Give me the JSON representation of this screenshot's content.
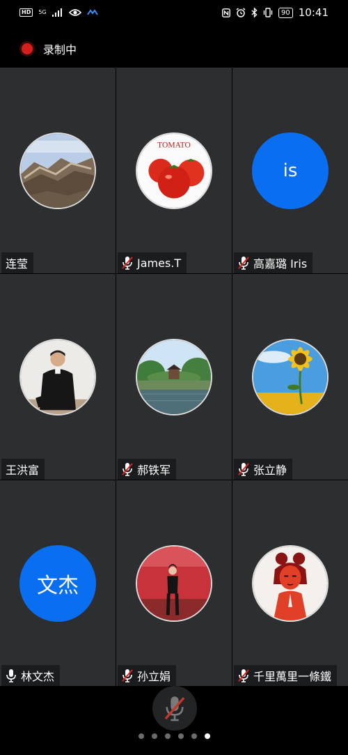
{
  "status_bar": {
    "network_badge": "HD",
    "signal_type": "5G",
    "battery": "90",
    "time": "10:41"
  },
  "recording": {
    "label": "录制中"
  },
  "participants": [
    {
      "name": "连莹",
      "mic": "none"
    },
    {
      "name": "James.T",
      "mic": "muted"
    },
    {
      "name": "高嘉璐 Iris",
      "mic": "muted",
      "initials": "is"
    },
    {
      "name": "王洪富",
      "mic": "none"
    },
    {
      "name": "郝铁军",
      "mic": "muted"
    },
    {
      "name": "张立静",
      "mic": "muted"
    },
    {
      "name": "林文杰",
      "mic": "on",
      "initials": "文杰"
    },
    {
      "name": "孙立娟",
      "mic": "muted"
    },
    {
      "name": "千里萬里一條鐵",
      "mic": "muted"
    }
  ],
  "avatar_texts": {
    "tomato": "TOMATO"
  },
  "colors": {
    "accent_blue": "#0a6ef0",
    "record_red": "#d41f1f",
    "muted_red": "#e02020",
    "tile_bg": "#2d2e30"
  },
  "pager": {
    "total": 6,
    "active": 6
  }
}
